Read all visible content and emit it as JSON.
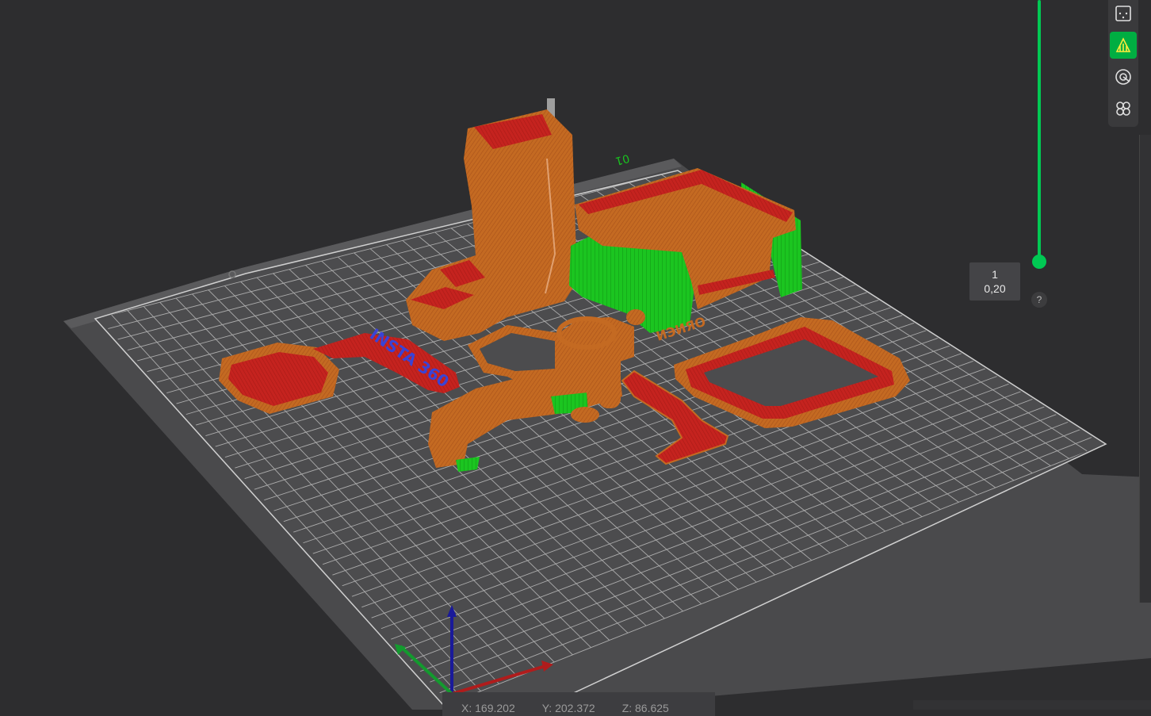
{
  "bed": {
    "plate_label": "01"
  },
  "objects": {
    "engraved_text": "INSTA 360",
    "side_text": "ИЭИЯО"
  },
  "layer_slider": {
    "layer_number": "1",
    "layer_height": "0,20",
    "help_label": "?"
  },
  "toolbar": {
    "items": [
      {
        "name": "layout-icon",
        "active": false
      },
      {
        "name": "support-paint-icon",
        "active": true
      },
      {
        "name": "seam-paint-icon",
        "active": false
      },
      {
        "name": "fuzzy-skin-icon",
        "active": false
      }
    ]
  },
  "coordinates": {
    "x": "X: 169.202",
    "y": "Y: 202.372",
    "z": "Z: 86.625"
  },
  "colors": {
    "background": "#2d2d2f",
    "bed": "#4a4a4c",
    "grid": "#c8c8c8",
    "wall_orange": "#c8691f",
    "top_red": "#c7231f",
    "support_green": "#19c21f",
    "accent_green": "#00c853"
  }
}
